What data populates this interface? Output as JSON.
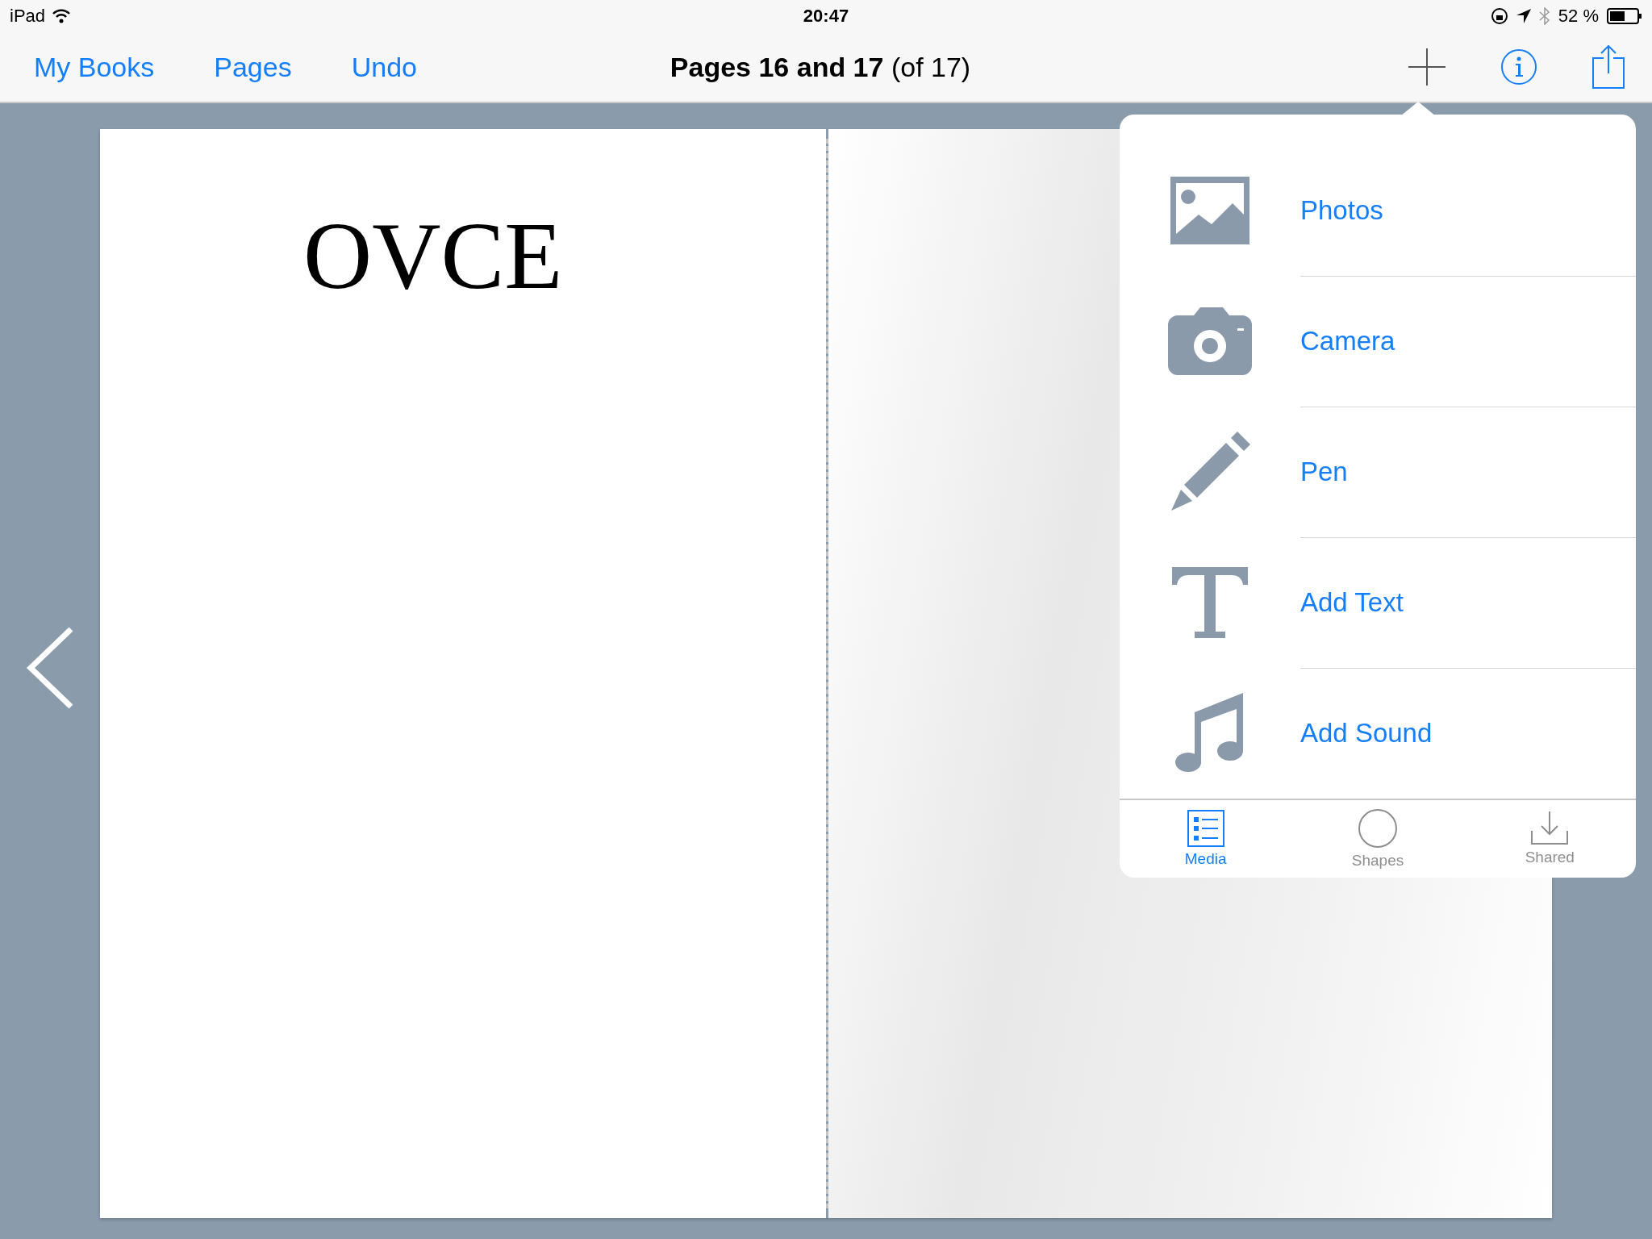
{
  "status_bar": {
    "device": "iPad",
    "time": "20:47",
    "battery": "52 %"
  },
  "toolbar": {
    "left_buttons": [
      "My Books",
      "Pages",
      "Undo"
    ],
    "title": "**Pages 16 and 17** (of 17)"
  },
  "book": {
    "left_page_title": "OVCE"
  },
  "insert_popover": {
    "items": [
      {
        "kind": "photos",
        "label": "Photos"
      },
      {
        "kind": "camera",
        "label": "Camera"
      },
      {
        "kind": "pen",
        "label": "Pen"
      },
      {
        "kind": "text",
        "label": "Add Text"
      },
      {
        "kind": "sound",
        "label": "Add Sound"
      }
    ],
    "tabs": [
      {
        "kind": "media",
        "label": "Media",
        "selected": true
      },
      {
        "kind": "shapes",
        "label": "Shapes",
        "selected": false
      },
      {
        "kind": "shared",
        "label": "Shared",
        "selected": false
      }
    ]
  }
}
